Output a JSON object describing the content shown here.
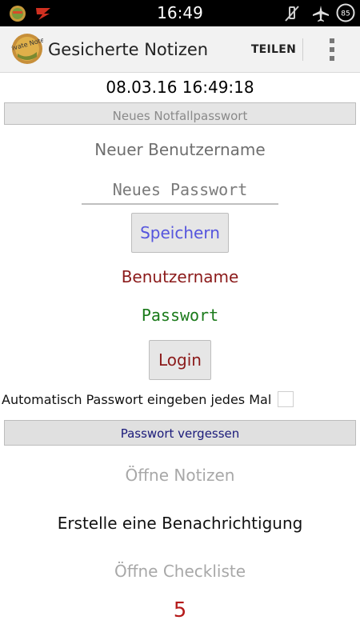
{
  "status_bar": {
    "time": "16:49",
    "battery_level": "85",
    "icons": [
      "app-notification-icon",
      "flash-notification-icon",
      "mute-icon",
      "airplane-mode-icon",
      "battery-icon"
    ]
  },
  "action_bar": {
    "app_icon_text": "Private Notes",
    "title": "Gesicherte Notizen",
    "share_label": "TEILEN",
    "overflow_icon": "overflow-menu-icon"
  },
  "main": {
    "datetime": "08.03.16 16:49:18",
    "emergency_password_button": "Neues Notfallpasswort",
    "new_username": "Neuer Benutzername",
    "new_password_placeholder": "Neues Passwort",
    "save_button": "Speichern",
    "username": "Benutzername",
    "password": "Passwort",
    "login_button": "Login",
    "auto_password_label": "Automatisch Passwort eingeben jedes Mal",
    "auto_password_checked": false,
    "forgot_password_button": "Passwort vergessen",
    "open_notes": "Öffne Notizen",
    "create_notification": "Erstelle eine Benachrichtigung",
    "open_checklist": "Öffne Checkliste",
    "counter": "5"
  },
  "colors": {
    "status_bar_bg": "#000000",
    "action_bar_bg": "#f2f2f2",
    "save_text": "#5555dd",
    "username_text": "#8b1a1a",
    "password_text": "#1a7a1a",
    "login_text": "#8b1a1a",
    "forgot_text": "#1a1a7a",
    "disabled_text": "#a8a8a8",
    "counter_text": "#b51a1a"
  }
}
